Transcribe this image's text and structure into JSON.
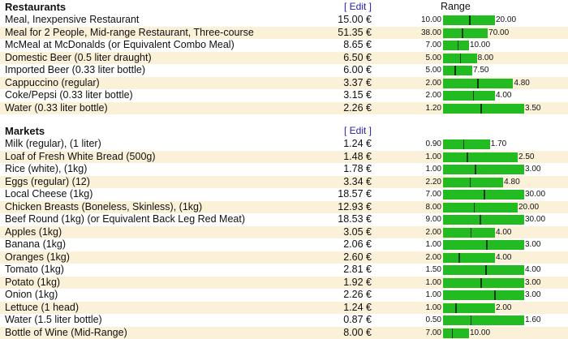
{
  "range_header": "Range",
  "edit_label": "[ Edit ]",
  "sections": [
    {
      "title": "Restaurants",
      "rows": [
        {
          "item": "Meal, Inexpensive Restaurant",
          "price": "15.00 €",
          "min": "10.00",
          "max": "20.00",
          "price_value": 15.0,
          "min_value": 10.0,
          "max_value": 20.0
        },
        {
          "item": "Meal for 2 People, Mid-range Restaurant, Three-course",
          "price": "51.35 €",
          "min": "38.00",
          "max": "70.00",
          "price_value": 51.35,
          "min_value": 38.0,
          "max_value": 70.0
        },
        {
          "item": "McMeal at McDonalds (or Equivalent Combo Meal)",
          "price": "8.65 €",
          "min": "7.00",
          "max": "10.00",
          "price_value": 8.65,
          "min_value": 7.0,
          "max_value": 10.0
        },
        {
          "item": "Domestic Beer (0.5 liter draught)",
          "price": "6.50 €",
          "min": "5.00",
          "max": "8.00",
          "price_value": 6.5,
          "min_value": 5.0,
          "max_value": 8.0
        },
        {
          "item": "Imported Beer (0.33 liter bottle)",
          "price": "6.00 €",
          "min": "5.00",
          "max": "7.50",
          "price_value": 6.0,
          "min_value": 5.0,
          "max_value": 7.5
        },
        {
          "item": "Cappuccino (regular)",
          "price": "3.37 €",
          "min": "2.00",
          "max": "4.80",
          "price_value": 3.37,
          "min_value": 2.0,
          "max_value": 4.8
        },
        {
          "item": "Coke/Pepsi (0.33 liter bottle)",
          "price": "3.15 €",
          "min": "2.00",
          "max": "4.00",
          "price_value": 3.15,
          "min_value": 2.0,
          "max_value": 4.0
        },
        {
          "item": "Water (0.33 liter bottle)",
          "price": "2.26 €",
          "min": "1.20",
          "max": "3.50",
          "price_value": 2.26,
          "min_value": 1.2,
          "max_value": 3.5
        }
      ]
    },
    {
      "title": "Markets",
      "rows": [
        {
          "item": "Milk (regular), (1 liter)",
          "price": "1.24 €",
          "min": "0.90",
          "max": "1.70",
          "price_value": 1.24,
          "min_value": 0.9,
          "max_value": 1.7
        },
        {
          "item": "Loaf of Fresh White Bread (500g)",
          "price": "1.48 €",
          "min": "1.00",
          "max": "2.50",
          "price_value": 1.48,
          "min_value": 1.0,
          "max_value": 2.5
        },
        {
          "item": "Rice (white), (1kg)",
          "price": "1.78 €",
          "min": "1.00",
          "max": "3.00",
          "price_value": 1.78,
          "min_value": 1.0,
          "max_value": 3.0
        },
        {
          "item": "Eggs (regular) (12)",
          "price": "3.34 €",
          "min": "2.20",
          "max": "4.80",
          "price_value": 3.34,
          "min_value": 2.2,
          "max_value": 4.8
        },
        {
          "item": "Local Cheese (1kg)",
          "price": "18.57 €",
          "min": "7.00",
          "max": "30.00",
          "price_value": 18.57,
          "min_value": 7.0,
          "max_value": 30.0
        },
        {
          "item": "Chicken Breasts (Boneless, Skinless), (1kg)",
          "price": "12.93 €",
          "min": "8.00",
          "max": "20.00",
          "price_value": 12.93,
          "min_value": 8.0,
          "max_value": 20.0
        },
        {
          "item": "Beef Round (1kg) (or Equivalent Back Leg Red Meat)",
          "price": "18.53 €",
          "min": "9.00",
          "max": "30.00",
          "price_value": 18.53,
          "min_value": 9.0,
          "max_value": 30.0
        },
        {
          "item": "Apples (1kg)",
          "price": "3.05 €",
          "min": "2.00",
          "max": "4.00",
          "price_value": 3.05,
          "min_value": 2.0,
          "max_value": 4.0
        },
        {
          "item": "Banana (1kg)",
          "price": "2.06 €",
          "min": "1.00",
          "max": "3.00",
          "price_value": 2.06,
          "min_value": 1.0,
          "max_value": 3.0
        },
        {
          "item": "Oranges (1kg)",
          "price": "2.60 €",
          "min": "2.00",
          "max": "4.00",
          "price_value": 2.6,
          "min_value": 2.0,
          "max_value": 4.0
        },
        {
          "item": "Tomato (1kg)",
          "price": "2.81 €",
          "min": "1.50",
          "max": "4.00",
          "price_value": 2.81,
          "min_value": 1.5,
          "max_value": 4.0
        },
        {
          "item": "Potato (1kg)",
          "price": "1.92 €",
          "min": "1.00",
          "max": "3.00",
          "price_value": 1.92,
          "min_value": 1.0,
          "max_value": 3.0
        },
        {
          "item": "Onion (1kg)",
          "price": "2.26 €",
          "min": "1.00",
          "max": "3.00",
          "price_value": 2.26,
          "min_value": 1.0,
          "max_value": 3.0
        },
        {
          "item": "Lettuce (1 head)",
          "price": "1.24 €",
          "min": "1.00",
          "max": "2.00",
          "price_value": 1.24,
          "min_value": 1.0,
          "max_value": 2.0
        },
        {
          "item": "Water (1.5 liter bottle)",
          "price": "0.87 €",
          "min": "0.50",
          "max": "1.60",
          "price_value": 0.87,
          "min_value": 0.5,
          "max_value": 1.6
        },
        {
          "item": "Bottle of Wine (Mid-Range)",
          "price": "8.00 €",
          "min": "7.00",
          "max": "10.00",
          "price_value": 8.0,
          "min_value": 7.0,
          "max_value": 10.0
        }
      ]
    }
  ],
  "colors": {
    "bar": "#22bb22",
    "tick": "#0a3a0a",
    "row_alt": "#fbf0d8",
    "edit_link": "#2222aa"
  }
}
